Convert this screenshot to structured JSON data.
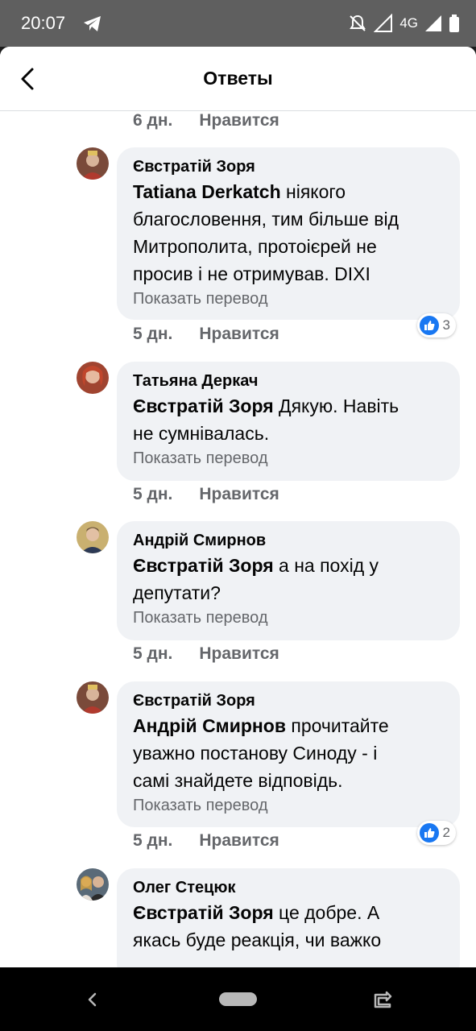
{
  "status_bar": {
    "time": "20:07",
    "network": "4G"
  },
  "header": {
    "title": "Ответы"
  },
  "colors": {
    "bubble": "#f0f2f5",
    "like_blue": "#1877f2",
    "muted": "#65676b"
  },
  "top_meta": {
    "time": "6 дн.",
    "like_label": "Нравится"
  },
  "comments": [
    {
      "author": "Євстратій Зоря",
      "mention": "Tatiana  Derkatch",
      "line1_rest": " ніякого",
      "lines": [
        "благословення, тим більше від",
        "Митрополита, протоієрей не",
        "просив і не отримував. DIXI"
      ],
      "translate_label": "Показать перевод",
      "time": "5 дн.",
      "like_label": "Нравится",
      "reactions": "3"
    },
    {
      "author": "Татьяна Деркач",
      "mention": "Євстратій Зоря",
      "line1_rest": " Дякую. Навіть",
      "lines": [
        "не сумнівалась."
      ],
      "translate_label": "Показать перевод",
      "time": "5 дн.",
      "like_label": "Нравится"
    },
    {
      "author": "Андрій Смирнов",
      "mention": "Євстратій Зоря",
      "line1_rest": " а на похід у",
      "lines": [
        "депутати?"
      ],
      "translate_label": "Показать перевод",
      "time": "5 дн.",
      "like_label": "Нравится"
    },
    {
      "author": "Євстратій Зоря",
      "mention": "Андрій Смирнов",
      "line1_rest": " прочитайте",
      "lines": [
        "уважно постанову Синоду - і",
        "самі знайдете відповідь."
      ],
      "translate_label": "Показать перевод",
      "time": "5 дн.",
      "like_label": "Нравится",
      "reactions": "2"
    },
    {
      "author": "Олег Стецюк",
      "mention": "Євстратій Зоря",
      "line1_rest": " це добре. А",
      "lines": [
        "якась буде реакція, чи важко"
      ]
    }
  ]
}
